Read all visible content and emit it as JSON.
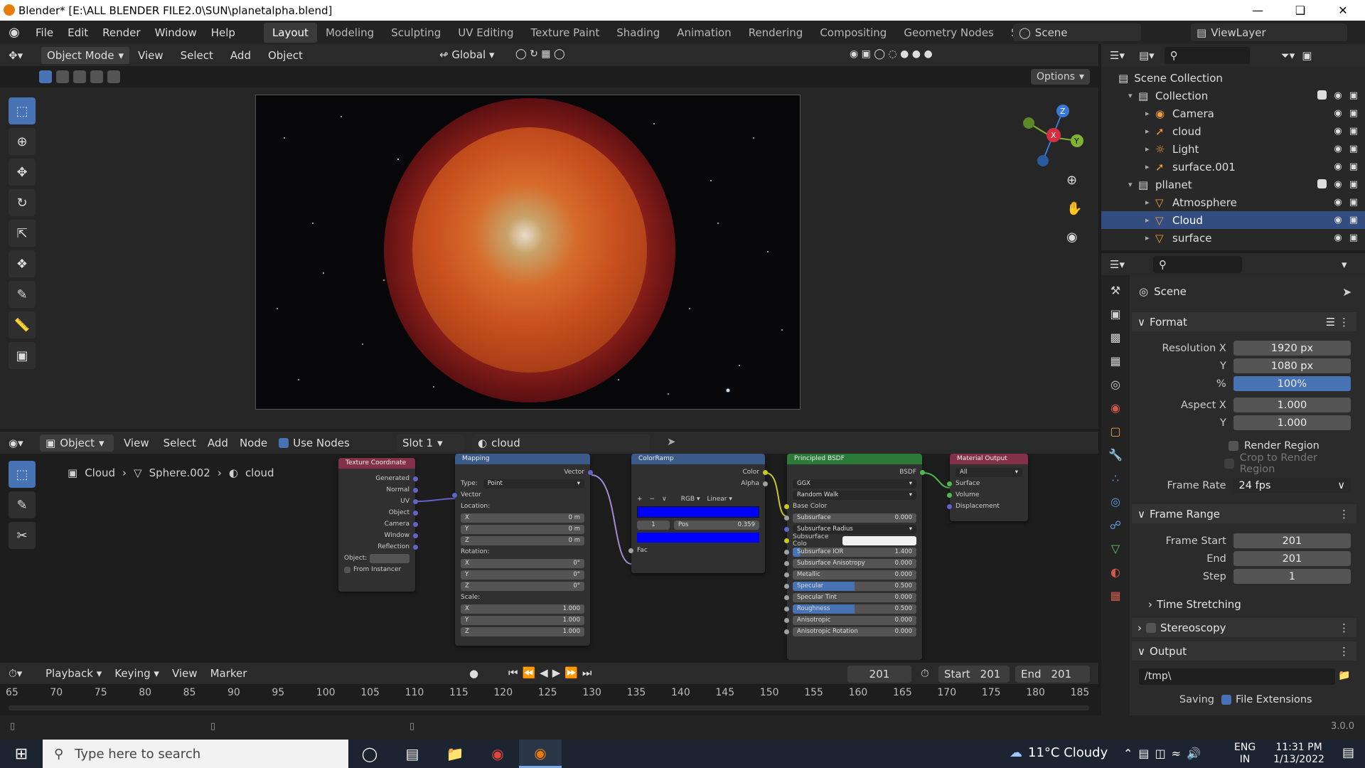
{
  "window": {
    "title": "Blender* [E:\\ALL BLENDER FILE2.0\\SUN\\planetalpha.blend]"
  },
  "menus": [
    "File",
    "Edit",
    "Render",
    "Window",
    "Help"
  ],
  "workspaces": [
    "Layout",
    "Modeling",
    "Sculpting",
    "UV Editing",
    "Texture Paint",
    "Shading",
    "Animation",
    "Rendering",
    "Compositing",
    "Geometry Nodes",
    "Scripting"
  ],
  "scene_name": "Scene",
  "view_layer": "ViewLayer",
  "viewport": {
    "mode": "Object Mode",
    "menus": [
      "View",
      "Select",
      "Add",
      "Object"
    ],
    "transform": "Global",
    "options_label": "Options"
  },
  "node_editor": {
    "type": "Object",
    "menus": [
      "View",
      "Select",
      "Add",
      "Node"
    ],
    "use_nodes_label": "Use Nodes",
    "slot": "Slot 1",
    "material": "cloud",
    "breadcrumb": [
      "Cloud",
      "Sphere.002",
      "cloud"
    ],
    "texcoord": {
      "title": "Texture Coordinate",
      "outputs": [
        "Generated",
        "Normal",
        "UV",
        "Object",
        "Camera",
        "Window",
        "Reflection"
      ],
      "object_label": "Object:",
      "from_instancer": "From Instancer"
    },
    "mapping": {
      "title": "Mapping",
      "output": "Vector",
      "type_label": "Type:",
      "type_value": "Point",
      "vector_label": "Vector",
      "location_label": "Location:",
      "loc": [
        [
          "X",
          "0 m"
        ],
        [
          "Y",
          "0 m"
        ],
        [
          "Z",
          "0 m"
        ]
      ],
      "rotation_label": "Rotation:",
      "rot": [
        [
          "X",
          "0°"
        ],
        [
          "Y",
          "0°"
        ],
        [
          "Z",
          "0°"
        ]
      ],
      "scale_label": "Scale:",
      "scale": [
        [
          "X",
          "1.000"
        ],
        [
          "Y",
          "1.000"
        ],
        [
          "Z",
          "1.000"
        ]
      ]
    },
    "colorramp": {
      "title": "ColorRamp",
      "outputs": [
        "Color",
        "Alpha"
      ],
      "mode": "RGB",
      "interp": "Linear",
      "index": "1",
      "pos_label": "Pos",
      "pos_value": "0.359",
      "fac_label": "Fac",
      "ramp_color": "#0000ff"
    },
    "bsdf": {
      "title": "Principled BSDF",
      "output": "BSDF",
      "dist": "GGX",
      "sss": "Random Walk",
      "base_color": "Base Color",
      "rows": [
        [
          "Subsurface",
          "0.000"
        ],
        [
          "Subsurface Radius",
          ""
        ],
        [
          "Subsurface Colo",
          ""
        ],
        [
          "Subsurface IOR",
          "1.400"
        ],
        [
          "Subsurface Anisotropy",
          "0.000"
        ],
        [
          "Metallic",
          "0.000"
        ],
        [
          "Specular",
          "0.500"
        ],
        [
          "Specular Tint",
          "0.000"
        ],
        [
          "Roughness",
          "0.500"
        ],
        [
          "Anisotropic",
          "0.000"
        ],
        [
          "Anisotropic Rotation",
          "0.000"
        ]
      ]
    },
    "output": {
      "title": "Material Output",
      "target": "All",
      "inputs": [
        "Surface",
        "Volume",
        "Displacement"
      ]
    }
  },
  "timeline": {
    "menus": [
      "Playback",
      "Keying",
      "View",
      "Marker"
    ],
    "current_frame": "201",
    "start_label": "Start",
    "start": "201",
    "end_label": "End",
    "end": "201",
    "ticks": [
      "65",
      "70",
      "75",
      "80",
      "85",
      "90",
      "95",
      "100",
      "105",
      "110",
      "115",
      "120",
      "125",
      "130",
      "135",
      "140",
      "145",
      "150",
      "155",
      "160",
      "165",
      "170",
      "175",
      "180",
      "185"
    ]
  },
  "outliner": {
    "root": "Scene Collection",
    "items": [
      {
        "name": "Collection",
        "indent": 1,
        "type": "collection"
      },
      {
        "name": "Camera",
        "indent": 2,
        "type": "camera"
      },
      {
        "name": "cloud",
        "indent": 2,
        "type": "curve"
      },
      {
        "name": "Light",
        "indent": 2,
        "type": "light"
      },
      {
        "name": "surface.001",
        "indent": 2,
        "type": "curve"
      },
      {
        "name": "pllanet",
        "indent": 1,
        "type": "collection"
      },
      {
        "name": "Atmosphere",
        "indent": 2,
        "type": "mesh"
      },
      {
        "name": "Cloud",
        "indent": 2,
        "type": "mesh",
        "selected": true
      },
      {
        "name": "surface",
        "indent": 2,
        "type": "mesh"
      }
    ]
  },
  "properties": {
    "context": "Scene",
    "format_label": "Format",
    "res_x_label": "Resolution X",
    "res_x": "1920 px",
    "res_y_label": "Y",
    "res_y": "1080 px",
    "pct_label": "%",
    "pct": "100%",
    "aspect_x_label": "Aspect X",
    "aspect_x": "1.000",
    "aspect_y_label": "Y",
    "aspect_y": "1.000",
    "render_region": "Render Region",
    "crop_region": "Crop to Render Region",
    "frame_rate_label": "Frame Rate",
    "frame_rate": "24 fps",
    "frame_range_label": "Frame Range",
    "frame_start_label": "Frame Start",
    "frame_start": "201",
    "end_label": "End",
    "end": "201",
    "step_label": "Step",
    "step": "1",
    "time_stretching": "Time Stretching",
    "stereoscopy": "Stereoscopy",
    "output_label": "Output",
    "output_path": "/tmp\\",
    "saving_label": "Saving",
    "file_ext": "File Extensions"
  },
  "version": "3.0.0",
  "taskbar": {
    "search_placeholder": "Type here to search",
    "weather": "11°C  Cloudy",
    "lang1": "ENG",
    "lang2": "IN",
    "time": "11:31 PM",
    "date": "1/13/2022"
  }
}
